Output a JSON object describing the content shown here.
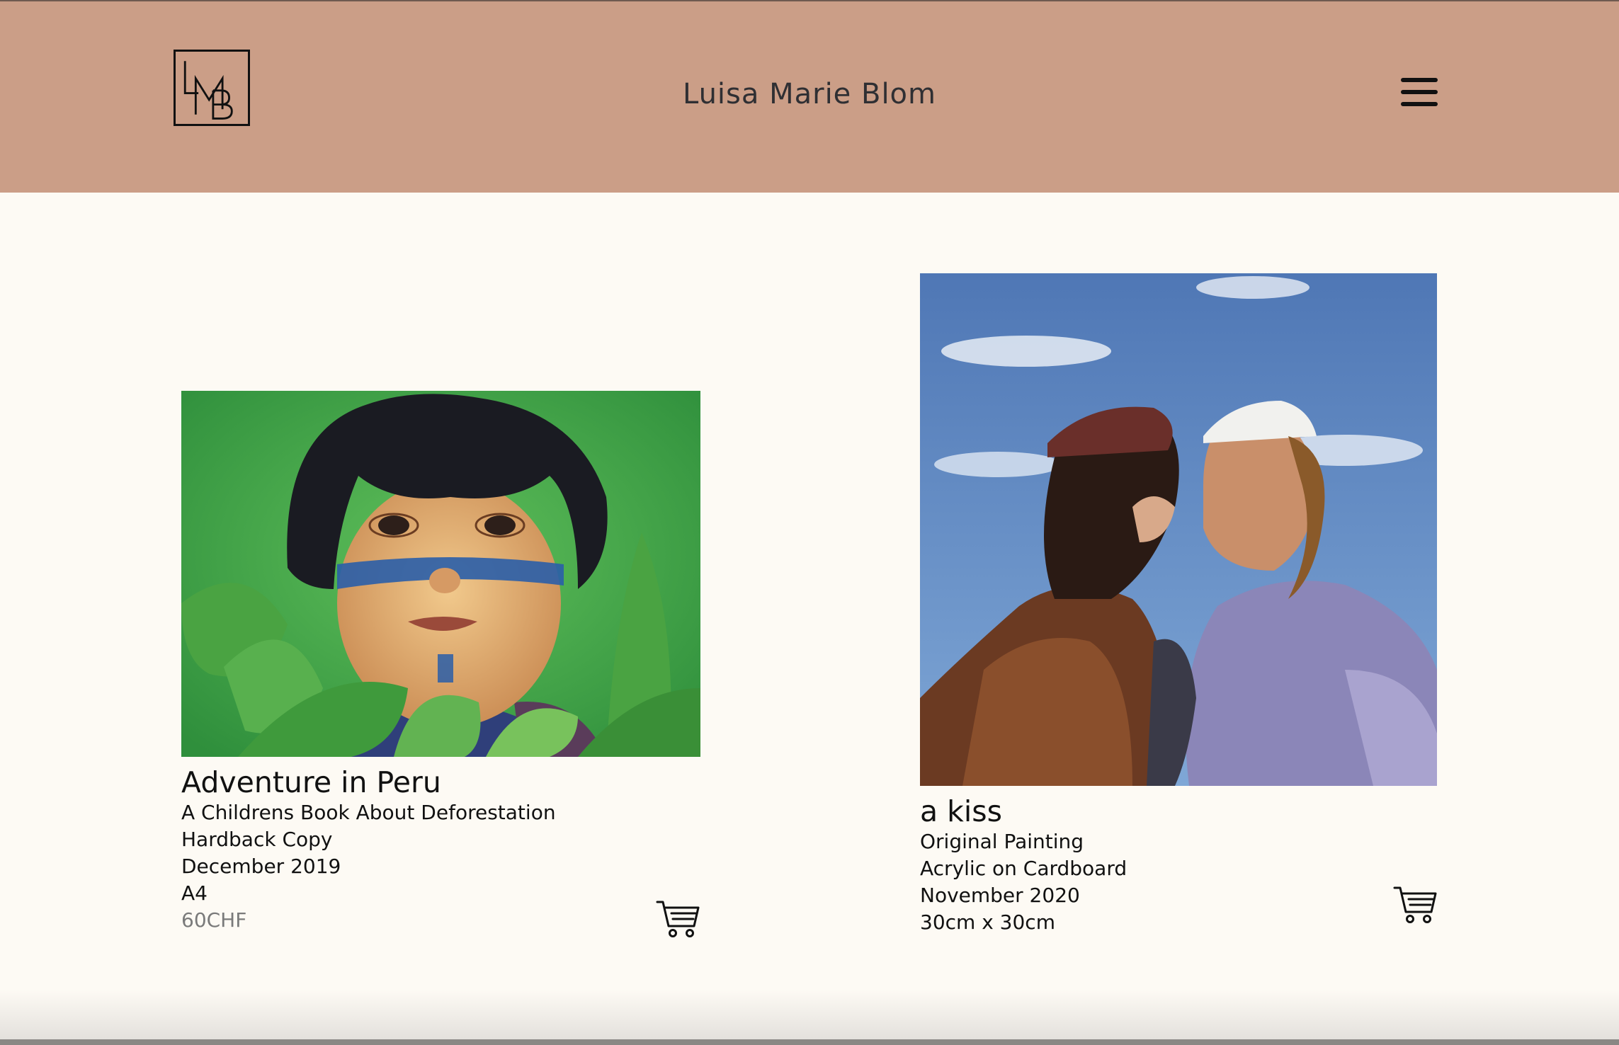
{
  "header": {
    "logo_text": "LMB",
    "site_title": "Luisa Marie Blom",
    "menu_icon": "hamburger-menu-icon",
    "background": "#cb9e87"
  },
  "products": [
    {
      "title": "Adventure in Peru",
      "lines": [
        "A Childrens Book About Deforestation",
        "Hardback Copy",
        "December 2019",
        "A4"
      ],
      "price": "60CHF",
      "cart_icon": "shopping-cart-icon"
    },
    {
      "title": "a kiss",
      "lines": [
        "Original Painting",
        "Acrylic on Cardboard",
        "November 2020",
        "30cm x 30cm"
      ],
      "cart_icon": "shopping-cart-icon"
    }
  ],
  "colors": {
    "page_background": "#fdfaf4",
    "text": "#111111",
    "price_text": "#7a7a7a"
  }
}
